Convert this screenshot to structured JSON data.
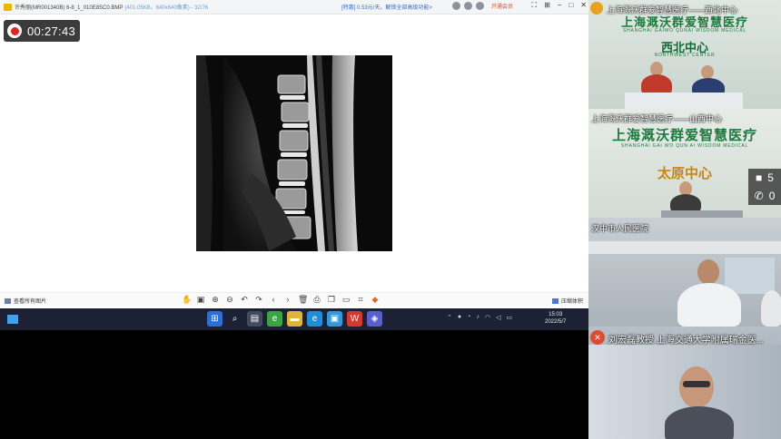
{
  "viewer": {
    "title": "许秀丽(MR001340B) 6-8_1_010E8SC0.BMP",
    "title_meta": "(401.05KB，640x640像素) - 32/76",
    "ad_text": "[特惠] 0.53元/天，解锁全部高级功能>",
    "member_label": "开通会员",
    "recording_time": "00:27:43",
    "show_all_label": "查看所有图片",
    "compress_label": "压缩体积"
  },
  "toolbar_icons": [
    "hand-icon",
    "fit-icon",
    "zoom-in-icon",
    "zoom-out-icon",
    "rotate-left-icon",
    "rotate-right-icon",
    "prev-icon",
    "next-icon",
    "delete-icon",
    "print-icon",
    "copy-icon",
    "folder-icon",
    "crop-icon",
    "more-icon"
  ],
  "taskbar": {
    "time": "15:03",
    "date": "2022/5/7"
  },
  "tiles": [
    {
      "label": "上海溉沃群爱智慧医疗——西北中心",
      "wall_cn": "上海溉沃群爱智慧医疗",
      "wall_en": "SHANGHAI GAIWO QUNAI WISDOM MEDICAL",
      "center_cn": "西北中心",
      "center_en": "NORTHWEST CENTER"
    },
    {
      "label": "上海溉沃群爱智慧医疗——山西中心",
      "wall_cn": "上海溉沃群爱智慧医疗",
      "wall_en": "SHANGHAI GAI WO QUN AI WISDOM MEDICAL",
      "center_cn": "太原中心",
      "video_count": "5",
      "phone_count": "0"
    },
    {
      "label": "汉中市人民医院"
    },
    {
      "label": "刘宏磊教授  上海交通大学附属瑞金医..."
    }
  ]
}
